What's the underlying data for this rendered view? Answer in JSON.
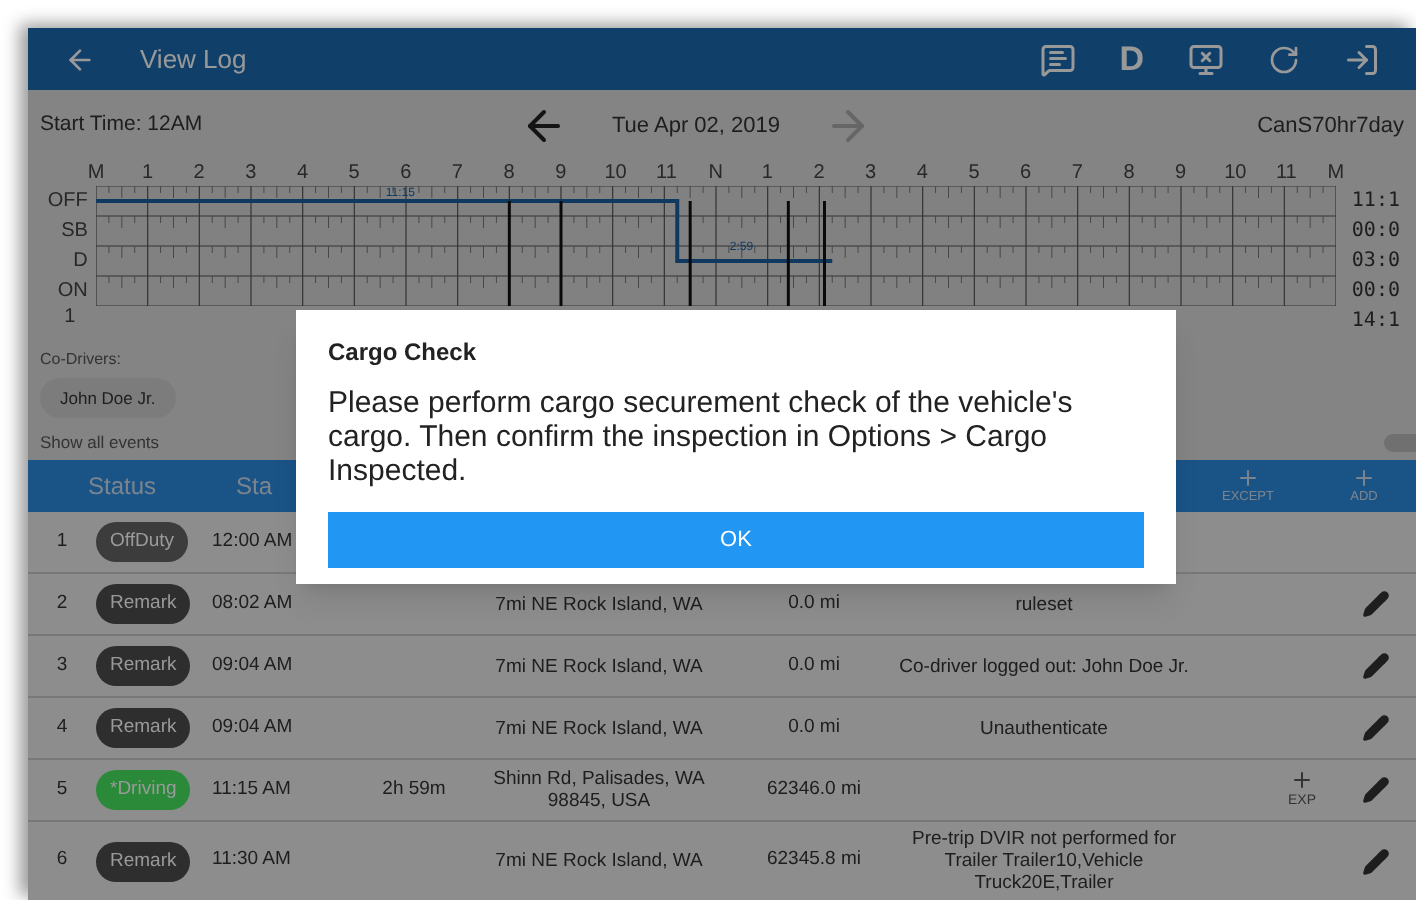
{
  "app_bar": {
    "title": "View Log",
    "d_label": "D"
  },
  "date_bar": {
    "start_time": "Start Time: 12AM",
    "date": "Tue Apr 02, 2019",
    "ruleset": "CanS70hr7day"
  },
  "graph": {
    "hour_labels": [
      "M",
      "1",
      "2",
      "3",
      "4",
      "5",
      "6",
      "7",
      "8",
      "9",
      "10",
      "11",
      "N",
      "1",
      "2",
      "3",
      "4",
      "5",
      "6",
      "7",
      "8",
      "9",
      "10",
      "11",
      "M"
    ],
    "row_labels": [
      "OFF",
      "SB",
      "D",
      "ON"
    ],
    "totals": [
      "11:1",
      "00:0",
      "03:0",
      "00:0",
      "14:1"
    ],
    "segment_labels": [
      "11:15",
      "2:59"
    ],
    "footer_label": "1"
  },
  "co_drivers": {
    "label": "Co-Drivers:",
    "names": [
      "John Doe Jr."
    ]
  },
  "show_all_events": {
    "label": "Show all events",
    "on": false
  },
  "table": {
    "columns": [
      "Status",
      "Sta"
    ],
    "actions": [
      {
        "label": "EXCEPT"
      },
      {
        "label": "ADD"
      }
    ],
    "rows": [
      {
        "index": "1",
        "status": "OffDuty",
        "color": "#3c3c3c",
        "time": "12:00 AM"
      },
      {
        "index": "2",
        "status": "Remark",
        "color": "#2e2e2e",
        "time": "08:02 AM",
        "location": "7mi NE Rock Island, WA",
        "distance": "0.0 mi",
        "note": "ruleset",
        "editable": true
      },
      {
        "index": "3",
        "status": "Remark",
        "color": "#2e2e2e",
        "time": "09:04 AM",
        "location": "7mi NE Rock Island, WA",
        "distance": "0.0 mi",
        "note": "Co-driver logged out: John Doe Jr.",
        "editable": true
      },
      {
        "index": "4",
        "status": "Remark",
        "color": "#2e2e2e",
        "time": "09:04 AM",
        "location": "7mi NE Rock Island, WA",
        "distance": "0.0 mi",
        "note": "Unauthenticate",
        "editable": true
      },
      {
        "index": "5",
        "status": "*Driving",
        "color": "#2b8a3a",
        "time": "11:15 AM",
        "duration": "2h 59m",
        "location": "Shinn Rd, Palisades, WA 98845, USA",
        "distance": "62346.0 mi",
        "exception": "EXP",
        "editable": true
      },
      {
        "index": "6",
        "status": "Remark",
        "color": "#2e2e2e",
        "time": "11:30 AM",
        "location": "7mi NE Rock Island, WA",
        "distance": "62345.8 mi",
        "note": "Pre-trip DVIR not performed for Trailer Trailer10,Vehicle Truck20E,Trailer",
        "editable": true
      }
    ]
  },
  "dialog": {
    "title": "Cargo Check",
    "message": "Please perform cargo securement check of the vehicle's cargo. Then confirm the inspection in Options > Cargo Inspected.",
    "button": "OK"
  }
}
